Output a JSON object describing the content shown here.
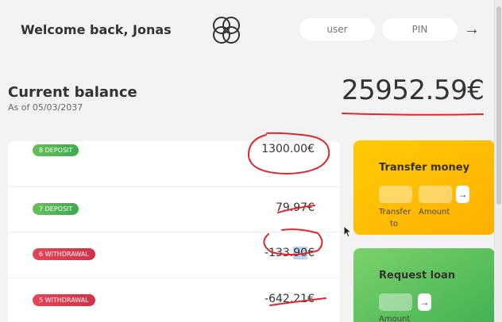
{
  "header": {
    "welcome": "Welcome back, Jonas",
    "user_placeholder": "user",
    "pin_placeholder": "PIN",
    "login_arrow": "→"
  },
  "balance": {
    "label": "Current balance",
    "date": "As of 05/03/2037",
    "value": "25952.59€"
  },
  "movements": [
    {
      "type_label": "8 DEPOSIT",
      "kind": "deposit",
      "amount": "1300.00€"
    },
    {
      "type_label": "7 DEPOSIT",
      "kind": "deposit",
      "amount": "79.97€"
    },
    {
      "type_label": "6 WITHDRAWAL",
      "kind": "withdrawal",
      "amount_pre": "-133.",
      "amount_hl": "90",
      "amount_post": "€"
    },
    {
      "type_label": "5 WITHDRAWAL",
      "kind": "withdrawal",
      "amount": "-642.21€"
    }
  ],
  "transfer": {
    "title": "Transfer money",
    "to_label_1": "Transfer",
    "to_label_2": "to",
    "amount_label": "Amount",
    "arrow": "→"
  },
  "loan": {
    "title": "Request loan",
    "amount_label": "Amount",
    "arrow": "→"
  },
  "colors": {
    "deposit": "#3dab4d",
    "withdrawal": "#e84456",
    "transfer_card": "#ffb003",
    "loan_card": "#4fba5d",
    "annotation": "#e0262b"
  }
}
